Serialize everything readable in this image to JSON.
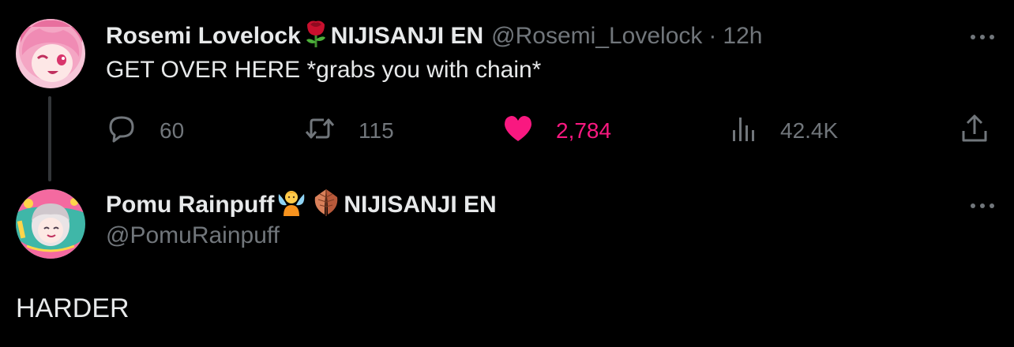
{
  "tweet": {
    "author_name": "Rosemi Lovelock",
    "author_suffix": "NIJISANJI EN",
    "handle": "@Rosemi_Lovelock",
    "separator": "·",
    "time": "12h",
    "text": "GET OVER HERE *grabs you with chain*",
    "name_emojis": [
      "rose-icon"
    ],
    "stats": {
      "replies": "60",
      "retweets": "115",
      "likes": "2,784",
      "views": "42.4K"
    },
    "liked": true
  },
  "reply": {
    "author_name": "Pomu Rainpuff",
    "author_suffix": "NIJISANJI EN",
    "handle": "@PomuRainpuff",
    "name_emojis": [
      "fairy-icon",
      "leaf-icon"
    ],
    "text": "HARDER"
  },
  "colors": {
    "background": "#000000",
    "text": "#e7e9ea",
    "muted": "#71767b",
    "like": "#f91880",
    "thread_line": "#333639"
  }
}
